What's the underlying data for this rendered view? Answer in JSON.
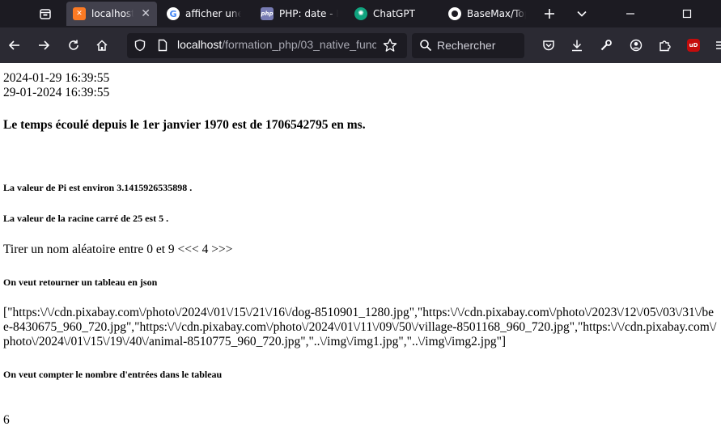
{
  "browser": {
    "tabs": [
      {
        "label": "localhost/f",
        "favicon": "xampp-icon",
        "active": true
      },
      {
        "label": "afficher une v",
        "favicon": "google-icon",
        "active": false
      },
      {
        "label": "PHP: date - M",
        "favicon": "php-icon",
        "active": false
      },
      {
        "label": "ChatGPT",
        "favicon": "chatgpt-icon",
        "active": false
      },
      {
        "label": "BaseMax/Top",
        "favicon": "github-icon",
        "active": false
      }
    ],
    "php_favicon_text": "php",
    "ublock_badge": "uD",
    "url_host": "localhost",
    "url_path": "/formation_php/03_native_func",
    "search_placeholder": "Rechercher"
  },
  "page": {
    "date_iso": "2024-01-29 16:39:55",
    "date_fr": "29-01-2024 16:39:55",
    "elapsed_heading": "Le temps écoulé depuis le 1er janvier 1970 est de 1706542795 en ms.",
    "pi_text": "La valeur de Pi est environ 3.1415926535898 .",
    "sqrt_text": "La valeur de la racine carré de 25 est 5 .",
    "random_text": "Tirer un nom aléatoire entre 0 et 9 <<< 4 >>>",
    "json_heading": "On veut retourner un tableau en json",
    "json_output": "[\"https:\\/\\/cdn.pixabay.com\\/photo\\/2024\\/01\\/15\\/21\\/16\\/dog-8510901_1280.jpg\",\"https:\\/\\/cdn.pixabay.com\\/photo\\/2023\\/12\\/05\\/03\\/31\\/bee-8430675_960_720.jpg\",\"https:\\/\\/cdn.pixabay.com\\/photo\\/2024\\/01\\/11\\/09\\/50\\/village-8501168_960_720.jpg\",\"https:\\/\\/cdn.pixabay.com\\/photo\\/2024\\/01\\/15\\/19\\/40\\/animal-8510775_960_720.jpg\",\"..\\/img\\/img1.jpg\",\"..\\/img\\/img2.jpg\"]",
    "count_heading": "On veut compter le nombre d'entrées dans le tableau",
    "count_value": "6"
  }
}
